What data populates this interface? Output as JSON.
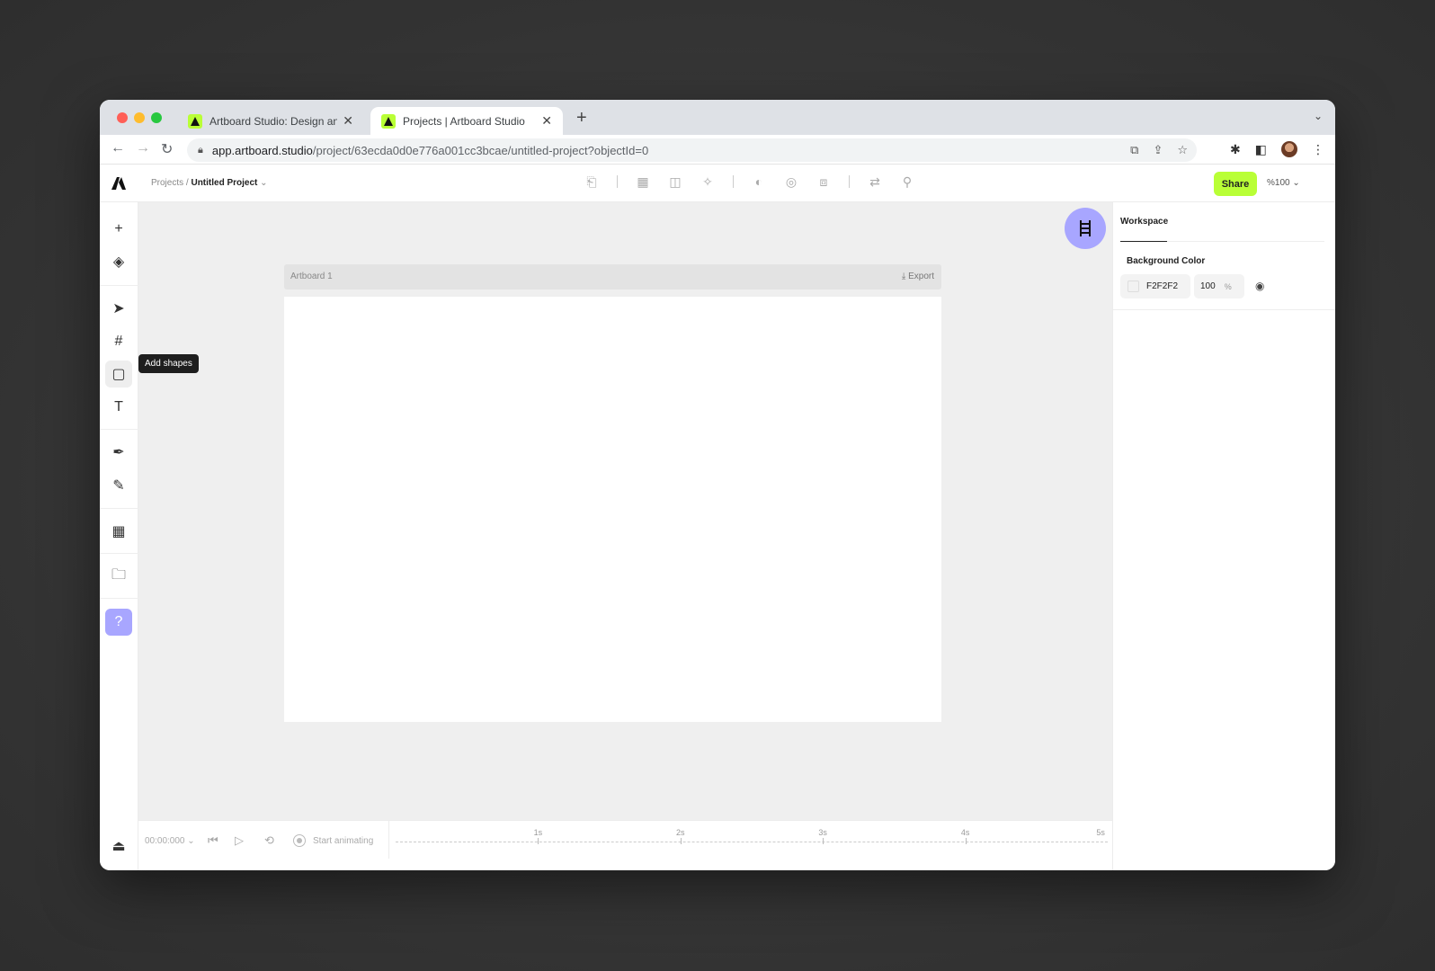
{
  "browser": {
    "tabs": [
      {
        "title": "Artboard Studio: Design and A",
        "active": false
      },
      {
        "title": "Projects | Artboard Studio",
        "active": true
      }
    ],
    "url_host": "app.artboard.studio",
    "url_path": "/project/63ecda0d0e776a001cc3bcae/untitled-project?objectId=0"
  },
  "header": {
    "breadcrumb_parent": "Projects /",
    "breadcrumb_current": "Untitled Project",
    "share_label": "Share",
    "zoom_label": "%100"
  },
  "rail": {
    "tooltip": "Add shapes"
  },
  "canvas": {
    "artboard_name": "Artboard 1",
    "export_label": "Export"
  },
  "timeline": {
    "time": "00:00:000",
    "start_label": "Start animating",
    "marks": [
      "1s",
      "2s",
      "3s",
      "4s",
      "5s"
    ]
  },
  "panel": {
    "tab_label": "Workspace",
    "bg_label": "Background Color",
    "bg_hex": "F2F2F2",
    "bg_opacity": "100",
    "opacity_unit": "%"
  },
  "colors": {
    "accent_green": "#b9ff36",
    "accent_purple": "#a8a6ff",
    "canvas_bg": "#efefef"
  }
}
